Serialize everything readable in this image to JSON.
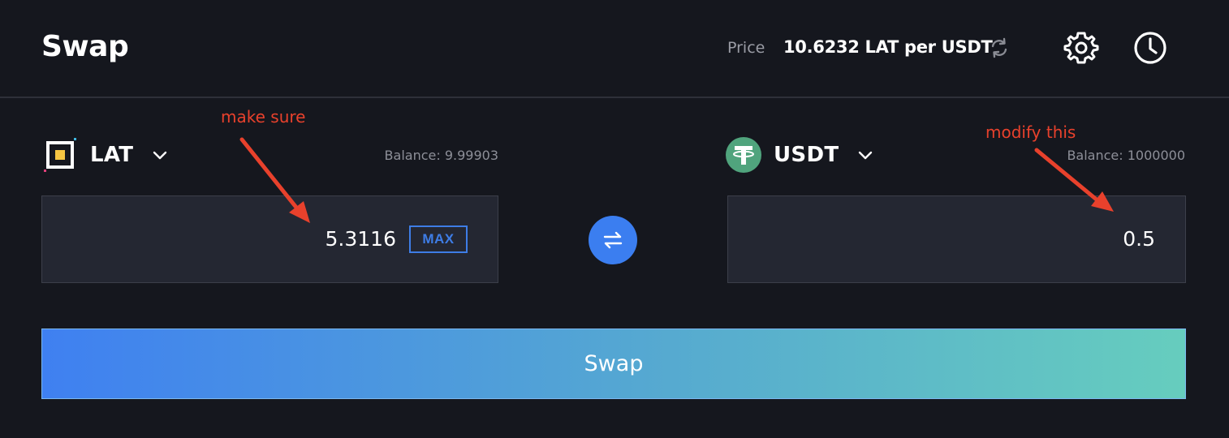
{
  "header": {
    "title": "Swap",
    "price_label": "Price",
    "price_value": "10.6232 LAT per USDT",
    "icons": [
      "refresh-icon",
      "gear-icon",
      "clock-icon"
    ]
  },
  "from": {
    "token": "LAT",
    "balance": "Balance: 9.99903",
    "amount": "5.3116",
    "max_label": "MAX",
    "icon": "lat-token-icon"
  },
  "to": {
    "token": "USDT",
    "balance": "Balance: 1000000",
    "amount": "0.5",
    "icon": "usdt-token-icon"
  },
  "swap_button": {
    "label": "Swap"
  },
  "annotations": {
    "first": "make sure",
    "second": "modify this"
  },
  "colors": {
    "background": "#15171e",
    "accent": "#3b7ef0",
    "annotation": "#e8412c",
    "usdt_green": "#50a47d"
  }
}
